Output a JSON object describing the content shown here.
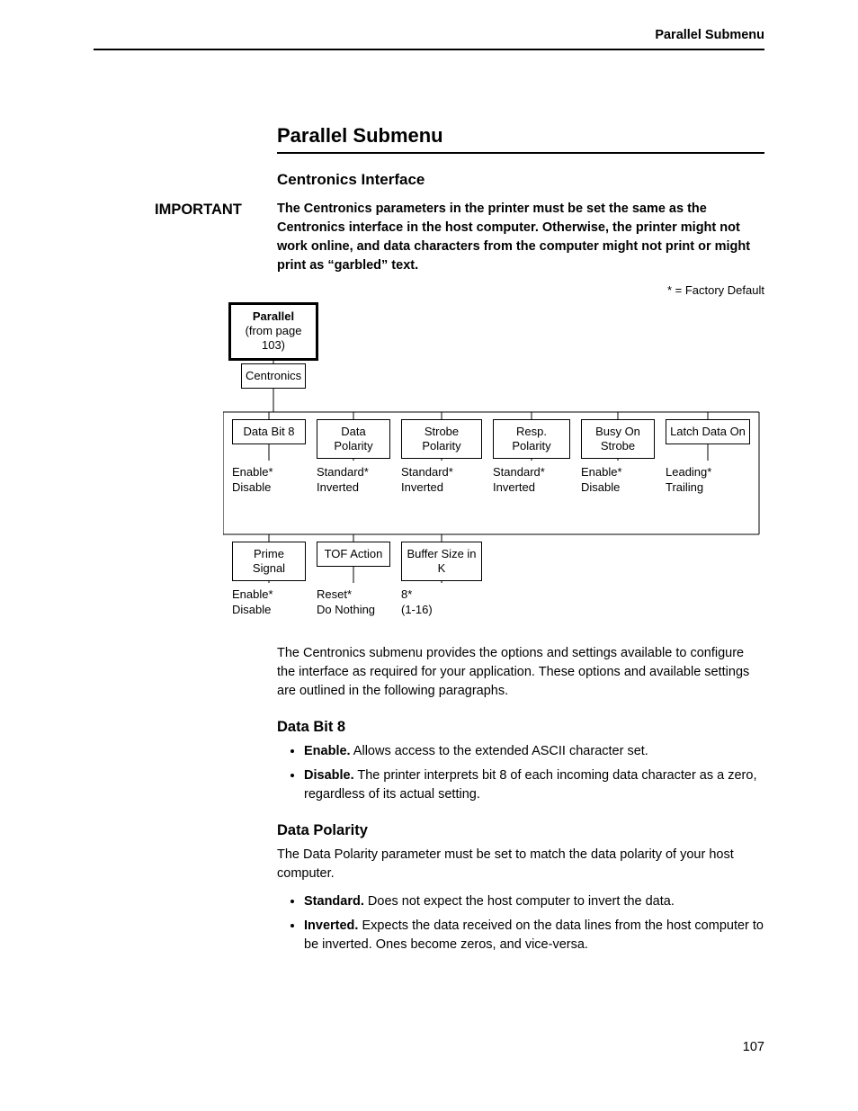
{
  "running_head": "Parallel Submenu",
  "section_title": "Parallel Submenu",
  "subsection_title": "Centronics Interface",
  "important_label": "IMPORTANT",
  "important_text": "The Centronics parameters in the printer must be set the same as the Centronics interface in the host computer. Otherwise, the printer might not work online, and data characters from the computer might not print or might print as “garbled” text.",
  "factory_default_note": "* = Factory Default",
  "diagram": {
    "root_title": "Parallel",
    "root_sub": "(from page 103)",
    "centronics": "Centronics",
    "row1": {
      "n1": "Data Bit 8",
      "n2": "Data Polarity",
      "n3": "Strobe Polarity",
      "n4": "Resp. Polarity",
      "n5": "Busy On Strobe",
      "n6": "Latch Data On"
    },
    "row1_opts": {
      "o1a": "Enable*",
      "o1b": "Disable",
      "o2a": "Standard*",
      "o2b": "Inverted",
      "o3a": "Standard*",
      "o3b": "Inverted",
      "o4a": "Standard*",
      "o4b": "Inverted",
      "o5a": "Enable*",
      "o5b": "Disable",
      "o6a": "Leading*",
      "o6b": "Trailing"
    },
    "row2": {
      "m1": "Prime Signal",
      "m2": "TOF Action",
      "m3": "Buffer Size in K"
    },
    "row2_opts": {
      "p1a": "Enable*",
      "p1b": "Disable",
      "p2a": "Reset*",
      "p2b": "Do Nothing",
      "p3a": "8*",
      "p3b": "(1-16)"
    }
  },
  "intro_paragraph": "The Centronics submenu provides the options and settings available to configure the interface as required for your application. These options and available settings are outlined in the following paragraphs.",
  "data_bit_8": {
    "title": "Data Bit 8",
    "enable_label": "Enable.",
    "enable_text": " Allows access to the extended ASCII character set.",
    "disable_label": "Disable.",
    "disable_text": " The printer interprets bit 8 of each incoming data character as a zero, regardless of its actual setting."
  },
  "data_polarity": {
    "title": "Data Polarity",
    "intro": "The Data Polarity parameter must be set to match the data polarity of your host computer.",
    "standard_label": "Standard.",
    "standard_text": " Does not expect the host computer to invert the data.",
    "inverted_label": "Inverted.",
    "inverted_text": " Expects the data received on the data lines from the host computer to be inverted. Ones become zeros, and vice-versa."
  },
  "page_number": "107"
}
